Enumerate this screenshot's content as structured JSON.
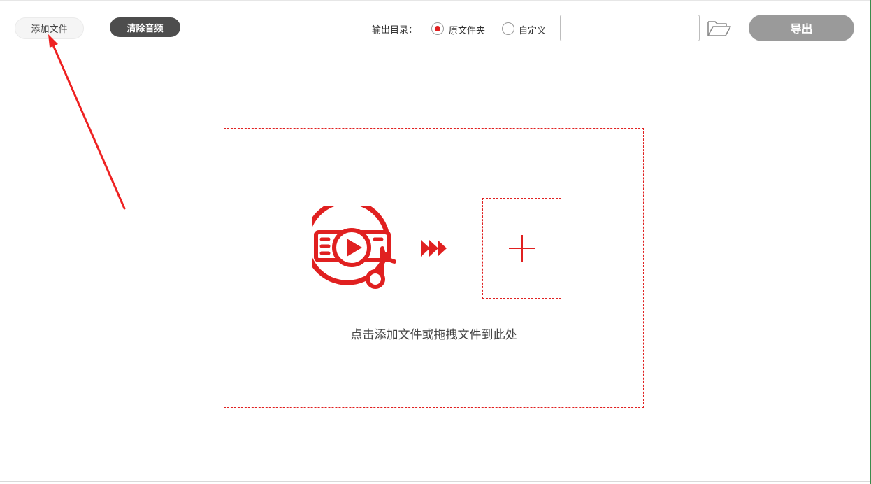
{
  "toolbar": {
    "add_file_label": "添加文件",
    "clear_audio_label": "清除音频",
    "output_dir_label": "输出目录：",
    "option_original": "原文件夹",
    "option_custom": "自定义",
    "selected_option": "原文件夹",
    "path_value": "",
    "export_label": "导出"
  },
  "dropzone": {
    "hint": "点击添加文件或拖拽文件到此处"
  },
  "icons": {
    "media": "video-music-disc-icon",
    "arrows": "fast-forward-arrows-icon",
    "add": "plus-icon",
    "folder": "folder-open-icon"
  },
  "colors": {
    "accent": "#e02020",
    "clear_button": "#4d4d4d",
    "export_button_disabled": "#9a9a9a",
    "annotation_arrow": "#ee2222"
  }
}
